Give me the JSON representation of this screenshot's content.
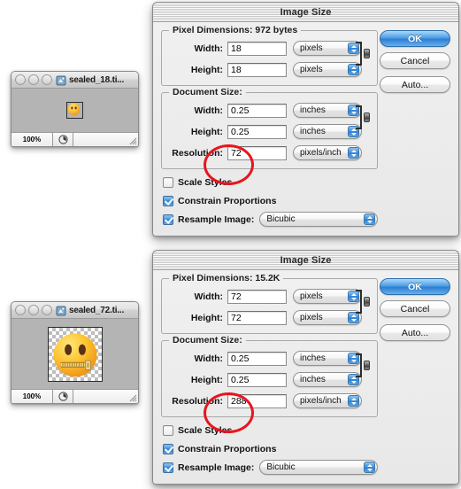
{
  "windows": [
    {
      "title": "sealed_18.ti...",
      "zoom": "100%",
      "icon": "photoshop-document-icon",
      "thumb_alt": "zipper-mouth-face-emoji"
    },
    {
      "title": "sealed_72.ti...",
      "zoom": "100%",
      "icon": "photoshop-document-icon",
      "thumb_alt": "zipper-mouth-face-emoji"
    }
  ],
  "dialogs": [
    {
      "title": "Image Size",
      "pixel_dimensions": {
        "legend_label": "Pixel Dimensions:",
        "size_value": "972 bytes",
        "width_label": "Width:",
        "width_value": "18",
        "width_unit": "pixels",
        "height_label": "Height:",
        "height_value": "18",
        "height_unit": "pixels"
      },
      "document_size": {
        "legend_label": "Document Size:",
        "width_label": "Width:",
        "width_value": "0.25",
        "width_unit": "inches",
        "height_label": "Height:",
        "height_value": "0.25",
        "height_unit": "inches",
        "resolution_label": "Resolution:",
        "resolution_value": "72",
        "resolution_unit": "pixels/inch"
      },
      "options": {
        "scale_styles_label": "Scale Styles",
        "scale_styles_checked": false,
        "constrain_label": "Constrain Proportions",
        "constrain_checked": true,
        "resample_label": "Resample Image:",
        "resample_checked": true,
        "resample_method": "Bicubic"
      },
      "buttons": {
        "ok": "OK",
        "cancel": "Cancel",
        "auto": "Auto..."
      }
    },
    {
      "title": "Image Size",
      "pixel_dimensions": {
        "legend_label": "Pixel Dimensions:",
        "size_value": "15.2K",
        "width_label": "Width:",
        "width_value": "72",
        "width_unit": "pixels",
        "height_label": "Height:",
        "height_value": "72",
        "height_unit": "pixels"
      },
      "document_size": {
        "legend_label": "Document Size:",
        "width_label": "Width:",
        "width_value": "0.25",
        "width_unit": "inches",
        "height_label": "Height:",
        "height_value": "0.25",
        "height_unit": "inches",
        "resolution_label": "Resolution:",
        "resolution_value": "288",
        "resolution_unit": "pixels/inch"
      },
      "options": {
        "scale_styles_label": "Scale Styles",
        "scale_styles_checked": false,
        "constrain_label": "Constrain Proportions",
        "constrain_checked": true,
        "resample_label": "Resample Image:",
        "resample_checked": true,
        "resample_method": "Bicubic"
      },
      "buttons": {
        "ok": "OK",
        "cancel": "Cancel",
        "auto": "Auto..."
      }
    }
  ],
  "annotations": {
    "highlight_color": "#e8141e",
    "shape": "ellipse-outline"
  }
}
